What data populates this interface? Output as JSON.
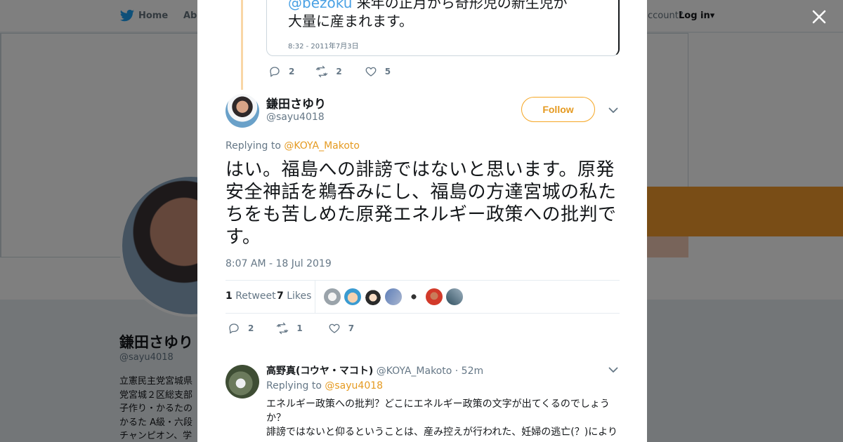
{
  "background": {
    "nav": {
      "home_label": "Home",
      "about_label": "Abo",
      "account_prompt": "ccount?",
      "login_label": "Log in"
    },
    "profile": {
      "name": "鎌田さゆり",
      "handle": "@sayu4018",
      "bio_lines": [
        "立憲民主党宮城県",
        "党宮城２区総支部",
        "子作り・かるたの",
        "かるた A級・六段",
        "チャンピオン、学"
      ]
    }
  },
  "quoted_tweet": {
    "text_mention": "@bezoku",
    "text_rest": " 来年の正月から奇形児の新生児が",
    "text_line2": "大量に産まれます。",
    "timestamp": "8:32 - 2011年7月3日",
    "replies": "2",
    "retweets": "2",
    "likes": "5"
  },
  "main_tweet": {
    "display_name": "鎌田さゆり",
    "handle": "@sayu4018",
    "follow_label": "Follow",
    "replying_prefix": "Replying to",
    "replying_to": "@KOYA_Makoto",
    "text": "はい。福島への誹謗ではないと思います。原発安全神話を鵜呑みにし、福島の方達宮城の私たちをも苦しめた原発エネルギー政策への批判です。",
    "timestamp": "8:07 AM - 18 Jul 2019",
    "retweet_count": "1",
    "retweet_label": "Retweet",
    "like_count": "7",
    "like_label": "Likes",
    "replies": "2",
    "retweets": "1",
    "likes": "7"
  },
  "reply_tweet": {
    "display_name": "高野真(コウヤ・マコト)",
    "handle": "@KOYA_Makoto",
    "age": "52m",
    "replying_prefix": "Replying to",
    "replying_to": "@sayu4018",
    "line1": "エネルギー政策への批判？どこにエネルギー政策の文字が出てくるのでしょうか？",
    "line2": "誹謗ではないと仰るということは、産み控えが行われた、妊婦の逃亡(？)により"
  },
  "colors": {
    "accent": "#e59a21",
    "mention_blue": "#4aa1e4",
    "muted": "#657786",
    "thread_line": "#f9d6a6"
  },
  "icons": [
    "twitter-bird-icon",
    "close-icon",
    "reply-icon",
    "retweet-icon",
    "heart-icon",
    "chevron-down-icon"
  ]
}
